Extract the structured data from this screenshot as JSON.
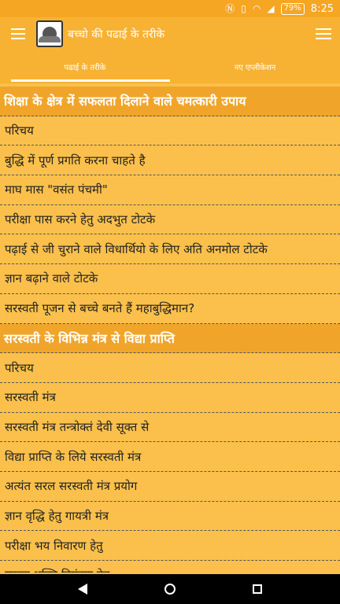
{
  "status_bar": {
    "battery": "79%",
    "time": "8:25"
  },
  "app_bar": {
    "title": "बच्चो की पढाई के तरीके"
  },
  "tabs": [
    {
      "label": "पढाई के तरीके",
      "active": true
    },
    {
      "label": "नए एप्लीकेशन",
      "active": false
    }
  ],
  "list": [
    {
      "text": "शिक्षा के क्षेत्र में सफलता दिलाने वाले चमत्कारी उपाय",
      "header": true
    },
    {
      "text": "परिचय",
      "header": false
    },
    {
      "text": "बुद्धि में पूर्ण प्रगति करना चाहते है",
      "header": false
    },
    {
      "text": "माघ मास \"वसंत पंचमी\"",
      "header": false
    },
    {
      "text": "परीक्षा पास करने हेतु अदभुत टोटके",
      "header": false
    },
    {
      "text": "पढ़ाई से जी चुराने वाले विधार्थियो के लिए अति अनमोल टोटके",
      "header": false
    },
    {
      "text": "ज्ञान बढ़ाने वाले टोटके",
      "header": false
    },
    {
      "text": "सरस्वती पूजन से बच्चे बनते हैं महाबुद्धिमान?",
      "header": false
    },
    {
      "text": "सरस्वती के विभिन्न मंत्र से विद्या प्राप्ति",
      "header": true
    },
    {
      "text": "परिचय",
      "header": false
    },
    {
      "text": "सरस्वती मंत्र",
      "header": false
    },
    {
      "text": "सरस्वती मंत्र तन्त्रोक्तं देवी सूक्त से",
      "header": false
    },
    {
      "text": "विद्या प्राप्ति के लिये सरस्वती मंत्र",
      "header": false
    },
    {
      "text": "अत्यंत सरल सरस्वती मंत्र प्रयोग",
      "header": false
    },
    {
      "text": "ज्ञान वृद्धि हेतु गायत्री मंत्र",
      "header": false
    },
    {
      "text": "परीक्षा भय निवारण हेतु",
      "header": false
    },
    {
      "text": "स्मरण शक्ति नियंत्रण हेतु",
      "header": false
    }
  ]
}
